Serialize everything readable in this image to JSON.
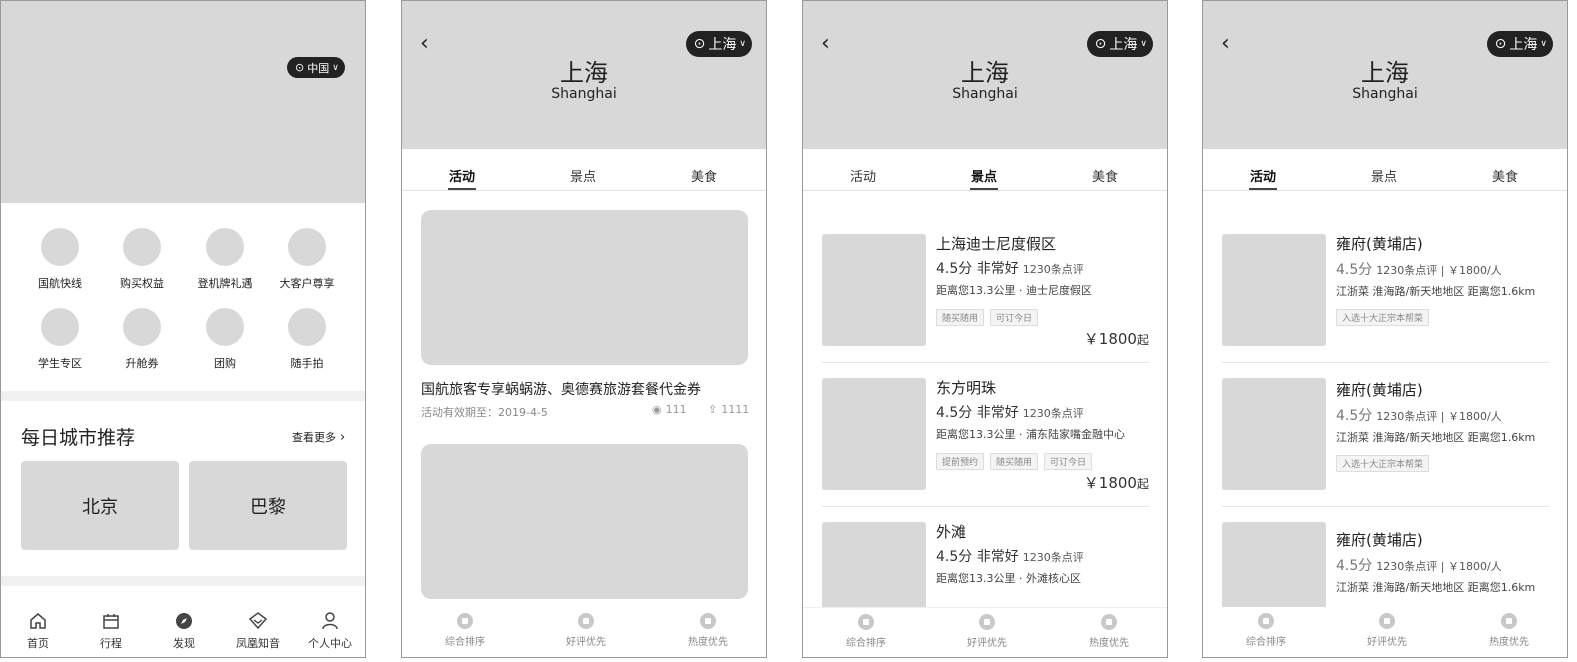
{
  "home": {
    "location": "中国",
    "grid": [
      "国航快线",
      "购买权益",
      "登机牌礼遇",
      "大客户尊享",
      "学生专区",
      "升舱券",
      "团购",
      "随手拍"
    ],
    "section_title": "每日城市推荐",
    "see_more": "查看更多",
    "cities": [
      "北京",
      "巴黎"
    ],
    "nav": [
      "首页",
      "行程",
      "发现",
      "凤凰知音",
      "个人中心"
    ]
  },
  "city": {
    "location": "上海",
    "name_cn": "上海",
    "name_en": "Shanghai",
    "tabs": [
      "活动",
      "景点",
      "美食"
    ]
  },
  "sort_nav": [
    "综合排序",
    "好评优先",
    "热度优先"
  ],
  "activities": [
    {
      "title": "国航旅客专享蜗蜗游、奥德赛旅游套餐代金券",
      "validity": "活动有效期至：2019-4-5",
      "views": "111",
      "shares": "1111"
    }
  ],
  "sights": [
    {
      "name": "上海迪士尼度假区",
      "score": "4.5分  非常好",
      "reviews": "1230条点评",
      "distance": "距离您13.3公里  ·  迪士尼度假区",
      "tags": [
        "随买随用",
        "可订今日"
      ],
      "price": "￥1800",
      "price_suffix": "起"
    },
    {
      "name": "东方明珠",
      "score": "4.5分  非常好",
      "reviews": "1230条点评",
      "distance": "距离您13.3公里  ·  浦东陆家嘴金融中心",
      "tags": [
        "提前预约",
        "随买随用",
        "可订今日"
      ],
      "price": "￥1800",
      "price_suffix": "起"
    },
    {
      "name": "外滩",
      "score": "4.5分  非常好",
      "reviews": "1230条点评",
      "distance": "距离您13.3公里  ·  外滩核心区",
      "tags": [],
      "price": "",
      "price_suffix": ""
    }
  ],
  "restaurants": [
    {
      "name": "雍府(黄埔店)",
      "score": "4.5分",
      "meta": "1230条点评 | ￥1800/人",
      "line": "江浙菜  淮海路/新天地地区  距离您1.6km",
      "tag": "入选十大正宗本帮菜"
    },
    {
      "name": "雍府(黄埔店)",
      "score": "4.5分",
      "meta": "1230条点评 | ￥1800/人",
      "line": "江浙菜  淮海路/新天地地区  距离您1.6km",
      "tag": "入选十大正宗本帮菜"
    },
    {
      "name": "雍府(黄埔店)",
      "score": "4.5分",
      "meta": "1230条点评 | ￥1800/人",
      "line": "江浙菜  淮海路/新天地地区  距离您1.6km",
      "tag": ""
    }
  ]
}
